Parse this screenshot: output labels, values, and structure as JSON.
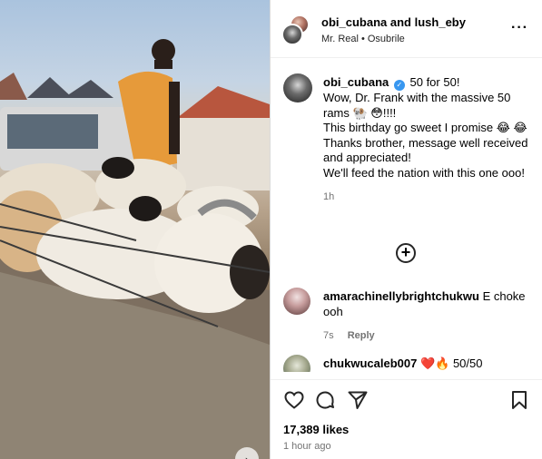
{
  "header": {
    "user1": "obi_cubana",
    "and": "and",
    "user2": "lush_eby",
    "audio": "Mr. Real",
    "location": "Osubrile",
    "more_icon": "more-horizontal-icon"
  },
  "caption": {
    "username": "obi_cubana",
    "line1": "50 for 50!",
    "line2": "Wow, Dr. Frank with the massive 50 rams 🐏 😳!!!!",
    "line3": "This birthday go sweet I promise 😂 😂",
    "line4": "Thanks brother, message well received and appreciated!",
    "line5": "We'll feed the nation with this one ooo!",
    "time": "1h"
  },
  "load_more_icon": "plus-circle-icon",
  "comments": [
    {
      "username": "amarachinellybrightchukwu",
      "text": "E choke ooh",
      "time": "7s",
      "reply": "Reply"
    },
    {
      "username": "chukwucaleb007",
      "text": "❤️🔥 50/50"
    }
  ],
  "actions": {
    "like_icon": "heart-icon",
    "comment_icon": "comment-icon",
    "share_icon": "send-icon",
    "save_icon": "bookmark-icon"
  },
  "likes": "17,389 likes",
  "posted": "1 hour ago",
  "colors": {
    "verified": "#3897f0",
    "muted": "#737373",
    "border": "#dbdbdb"
  }
}
